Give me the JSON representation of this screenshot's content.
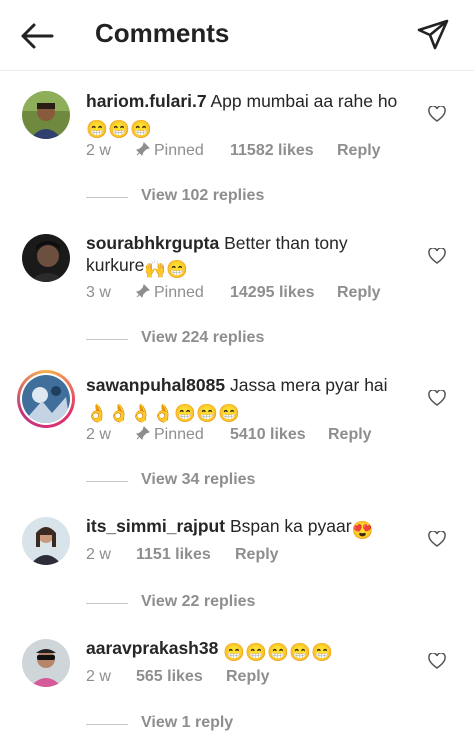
{
  "header": {
    "title": "Comments",
    "back_icon": "arrow-left-icon",
    "send_icon": "paper-plane-icon"
  },
  "comments": [
    {
      "username": "hariom.fulari.7",
      "text": "App mumbai aa rahe ho",
      "line2": "",
      "emojis": [
        "😁",
        "😁",
        "😁"
      ],
      "age": "2 w",
      "pinned": "Pinned",
      "likes": "11582 likes",
      "reply": "Reply",
      "view_replies": "View 102 replies"
    },
    {
      "username": "sourabhkrgupta",
      "text": "Better than tony",
      "line2": "kurkure",
      "emojis": [
        "🙌",
        "😁"
      ],
      "age": "3 w",
      "pinned": "Pinned",
      "likes": "14295 likes",
      "reply": "Reply",
      "view_replies": "View 224 replies"
    },
    {
      "username": "sawanpuhal8085",
      "text": "Jassa mera pyar hai",
      "line2": "",
      "emojis": [
        "👌",
        "👌",
        "👌",
        "👌",
        "😁",
        "😁",
        "😁"
      ],
      "age": "2 w",
      "pinned": "Pinned",
      "likes": "5410 likes",
      "reply": "Reply",
      "view_replies": "View 34 replies"
    },
    {
      "username": "its_simmi_rajput",
      "text": "Bspan ka pyaar",
      "line2": "",
      "emojis": [
        "😍"
      ],
      "age": "2 w",
      "likes": "1151 likes",
      "reply": "Reply",
      "view_replies": "View 22 replies"
    },
    {
      "username": "aaravprakash38",
      "text": "",
      "line2": "",
      "emojis": [
        "😁",
        "😁",
        "😁",
        "😁",
        "😁"
      ],
      "age": "2 w",
      "likes": "565 likes",
      "reply": "Reply",
      "view_replies": "View 1 reply"
    }
  ]
}
